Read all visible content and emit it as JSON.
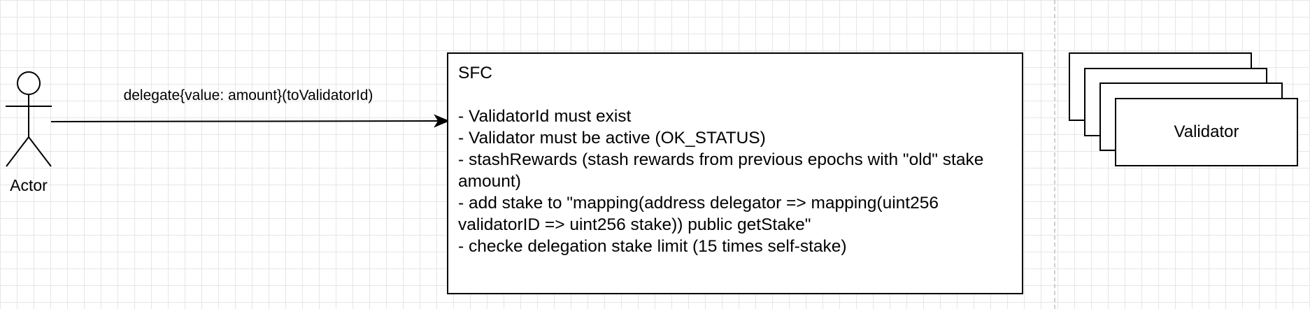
{
  "actor": {
    "label": "Actor"
  },
  "message": {
    "label": "delegate{value: amount}(toValidatorId)"
  },
  "sfc": {
    "title": "SFC",
    "rules": [
      "- ValidatorId must exist",
      "- Validator must be active (OK_STATUS)",
      "- stashRewards (stash rewards from previous epochs with \"old\" stake amount)",
      "- add stake to \"mapping(address delegator => mapping(uint256 validatorID => uint256 stake)) public getStake\"",
      "- checke delegation stake limit (15 times self-stake)"
    ]
  },
  "validator": {
    "label": "Validator"
  },
  "colors": {
    "stroke": "#000000",
    "grid": "#e6e6e6",
    "divider": "#cfcfcf",
    "background": "#ffffff"
  }
}
